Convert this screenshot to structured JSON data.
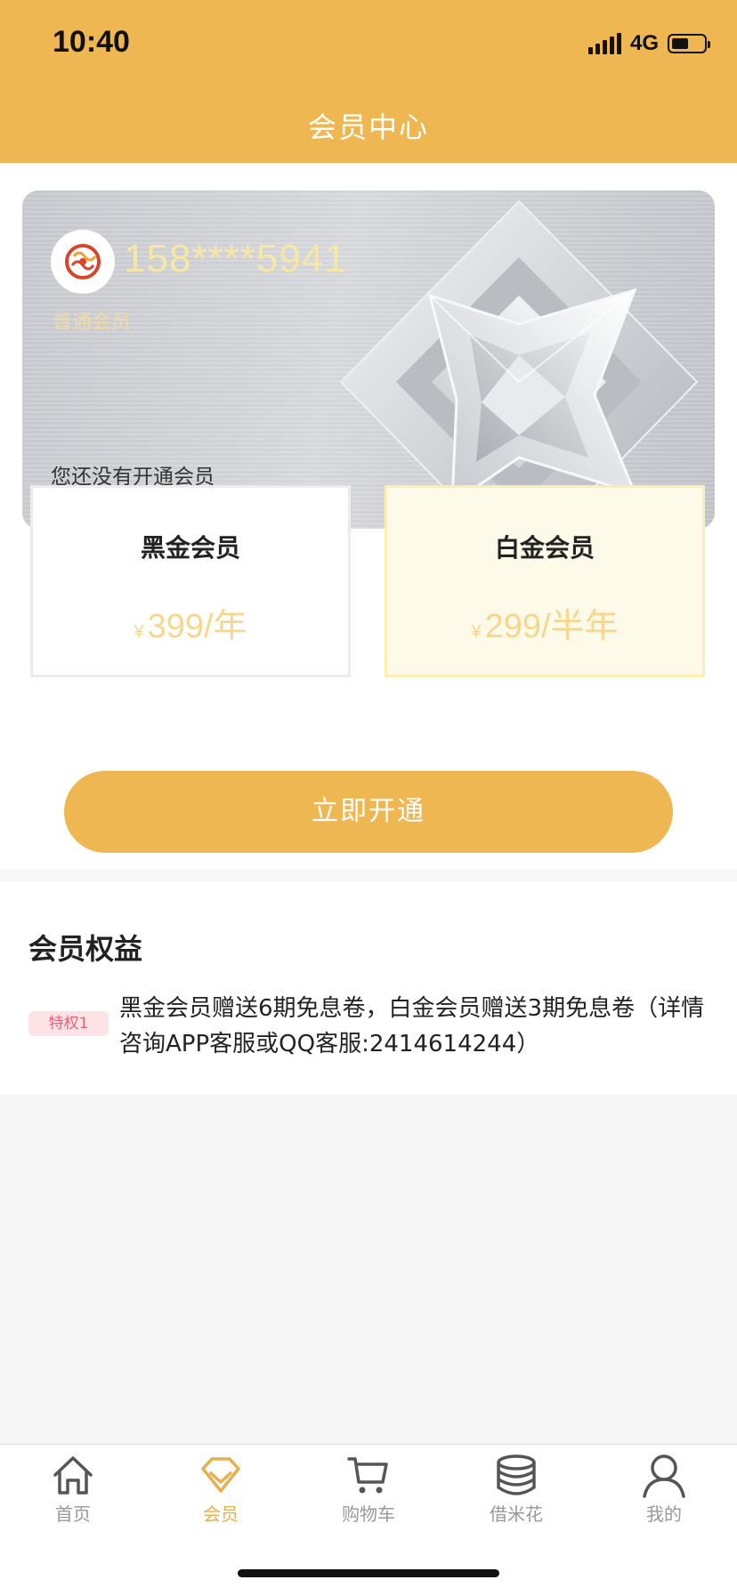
{
  "status_bar": {
    "time": "10:40",
    "network": "4G"
  },
  "header": {
    "title": "会员中心"
  },
  "card": {
    "phone": "158****5941",
    "level": "普通会员",
    "status": "您还没有开通会员"
  },
  "plans": [
    {
      "name": "黑金会员",
      "currency": "¥",
      "price": "399/年"
    },
    {
      "name": "白金会员",
      "currency": "¥",
      "price": "299/半年"
    }
  ],
  "open_button": "立即开通",
  "benefits": {
    "title": "会员权益",
    "items": [
      {
        "tag": "特权1",
        "text": "黑金会员赠送6期免息卷，白金会员赠送3期免息卷（详情咨询APP客服或QQ客服:2414614244）"
      }
    ]
  },
  "tabbar": {
    "items": [
      {
        "label": "首页",
        "icon": "home-icon"
      },
      {
        "label": "会员",
        "icon": "member-diamond-icon"
      },
      {
        "label": "购物车",
        "icon": "cart-icon"
      },
      {
        "label": "借米花",
        "icon": "coins-icon"
      },
      {
        "label": "我的",
        "icon": "profile-icon"
      }
    ],
    "active_index": 1
  },
  "colors": {
    "brand": "#eeb752",
    "plan_price": "#f6d78b",
    "tag_bg": "#fde3e6",
    "tag_text": "#e8617a",
    "active_tab": "#e8b04d"
  }
}
